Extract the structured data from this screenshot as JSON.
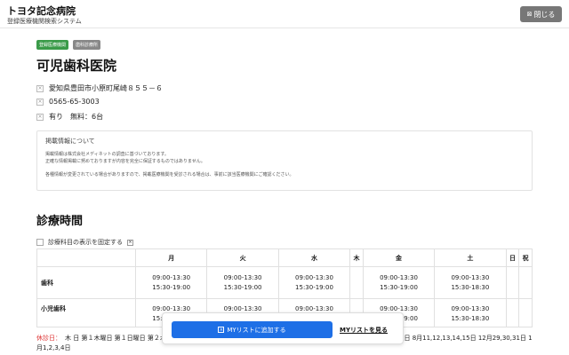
{
  "header": {
    "hospital_name": "トヨタ記念病院",
    "system_name": "登録医療機関検索システム",
    "close_icon": "close-icon",
    "close_label": "閉じる"
  },
  "badges": [
    "登録医療機関",
    "歯科診療所"
  ],
  "clinic": {
    "name": "可児歯科医院",
    "address": "愛知県豊田市小原町尾崎８５５－６",
    "phone": "0565-65-3003",
    "parking": "有り　無料：6台"
  },
  "notice": {
    "title": "掲載情報について",
    "line1": "掲載情報は株式会社メディネットの調査に基づいております。",
    "line2": "正確な情報掲載に努めておりますが内容を完全に保証するものではありません。",
    "line3": "各種情報が変更されている場合がありますので、掲載医療機関を受診される場合は、事前に該当医療機関にご確認ください。"
  },
  "schedule": {
    "section_title": "診療時間",
    "fix_label": "診療科目の表示を固定する",
    "days": [
      "月",
      "火",
      "水",
      "木",
      "金",
      "土",
      "日",
      "祝"
    ],
    "rows": [
      {
        "name": "歯科",
        "cells": [
          "09:00-13:30\n15:30-19:00",
          "09:00-13:30\n15:30-19:00",
          "09:00-13:30\n15:30-19:00",
          "",
          "09:00-13:30\n15:30-19:00",
          "09:00-13:30\n15:30-18:30",
          "",
          ""
        ]
      },
      {
        "name": "小児歯科",
        "cells": [
          "09:00-13:30\n15:30-19:00",
          "09:00-13:30\n15:30-19:00",
          "09:00-13:30\n15:30-19:00",
          "",
          "09:00-13:30\n15:30-19:00",
          "09:00-13:30\n15:30-18:30",
          "",
          ""
        ]
      }
    ]
  },
  "holiday": {
    "label": "休診日：",
    "text": "木 日 第１木曜日 第１日曜日 第２木曜日 第２日曜日 第３木曜日 第３日曜日 第４木曜日 第４日曜日 第５木曜日 第５日曜日 8月11,12,13,14,15日 12月29,30,31日 1月1,2,3,4日"
  },
  "actions": {
    "add_label": "MYリストに追加する",
    "view_label": "MYリストを見る"
  }
}
